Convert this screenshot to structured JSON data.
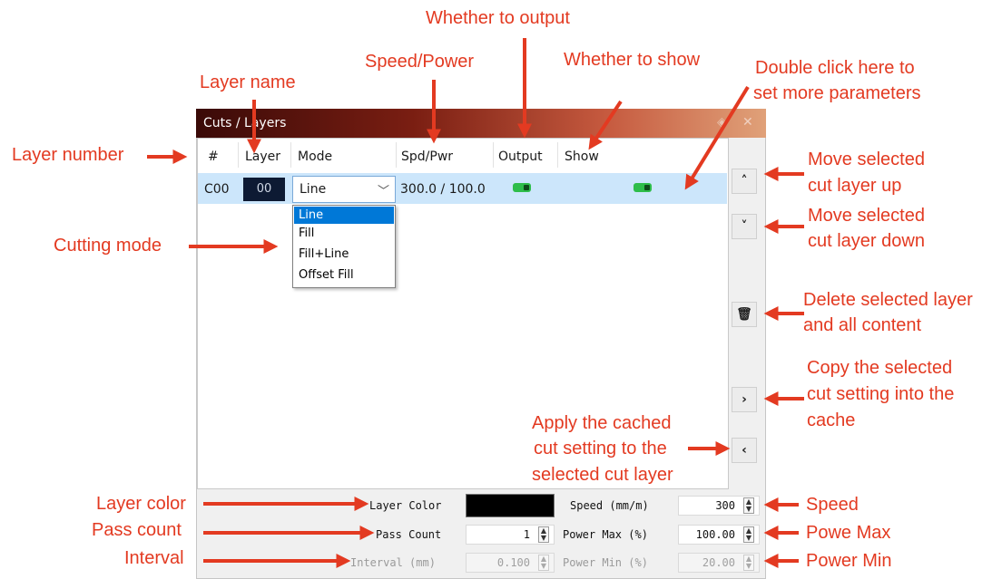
{
  "window": {
    "title": "Cuts / Layers",
    "title_buttons": [
      "◈",
      "✕"
    ]
  },
  "table": {
    "headers": [
      "#",
      "Layer",
      "Mode",
      "Spd/Pwr",
      "Output",
      "Show"
    ],
    "row": {
      "number": "C00",
      "layer": "00",
      "mode": "Line",
      "spd_pwr": "300.0 / 100.0",
      "output_on": true,
      "show_on": true
    }
  },
  "mode_dropdown": {
    "options": [
      "Line",
      "Fill",
      "Fill+Line",
      "Offset Fill"
    ],
    "selected": "Line"
  },
  "side_buttons": {
    "up": "˄",
    "down": "˅",
    "delete": "🗑",
    "copy": "›",
    "apply": "‹"
  },
  "settings": {
    "layer_color_label": "Layer Color",
    "layer_color": "#000000",
    "speed_label": "Speed (mm/m)",
    "speed_value": "300",
    "pass_count_label": "Pass Count",
    "pass_count_value": "1",
    "power_max_label": "Power Max (%)",
    "power_max_value": "100.00",
    "interval_label": "Interval (mm)",
    "interval_value": "0.100",
    "power_min_label": "Power Min (%)",
    "power_min_value": "20.00"
  },
  "annotations": {
    "whether_output": "Whether to output",
    "speed_power": "Speed/Power",
    "whether_show": "Whether to show",
    "double_click_1": "Double click here to",
    "double_click_2": "set more parameters",
    "layer_name": "Layer name",
    "layer_number": "Layer number",
    "cutting_mode": "Cutting mode",
    "move_up_1": "Move selected",
    "move_up_2": "cut layer up",
    "move_down_1": "Move selected",
    "move_down_2": "cut layer down",
    "delete_1": "Delete selected layer",
    "delete_2": "and all content",
    "copy_1": "Copy the selected",
    "copy_2": "cut setting into the",
    "copy_3": "cache",
    "apply_1": "Apply the cached",
    "apply_2": "cut setting to the",
    "apply_3": "selected cut layer",
    "layer_color": "Layer color",
    "pass_count": "Pass count",
    "interval": "Interval",
    "speed": "Speed",
    "power_max": "Powe Max",
    "power_min": "Power Min"
  },
  "colors": {
    "annotation": "#e33a21",
    "selection": "#cce6fb",
    "toggle_on": "#2ebd4a"
  }
}
